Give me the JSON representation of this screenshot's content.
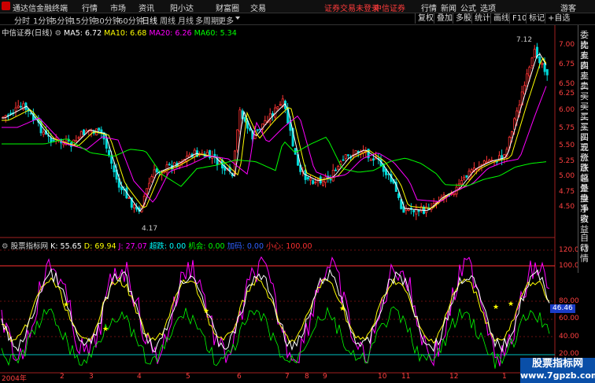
{
  "topbar": {
    "app_name": "通达信金融终端",
    "menus": [
      "行情",
      "市场",
      "资讯",
      "阳小达",
      "财富圈",
      "交易"
    ],
    "notice": "证券交易未登录",
    "broker": "中信证券",
    "right": [
      "行情",
      "新闻",
      "公式",
      "选项"
    ],
    "guest": "游客"
  },
  "periods": [
    "分时",
    "1分钟",
    "5分钟",
    "15分钟",
    "30分钟",
    "60分钟",
    "日线",
    "周线",
    "月线",
    "多周期",
    "更多"
  ],
  "active_period": "日线",
  "toolbar_right": [
    "复权",
    "叠加",
    "多股",
    "统计",
    "画线",
    "F10",
    "标记",
    "+自选"
  ],
  "ma": {
    "title": "中信证券(日线)",
    "items": [
      {
        "label": "MA5: 6.72",
        "color": "#ffffff"
      },
      {
        "label": "MA10: 6.68",
        "color": "#ffff00"
      },
      {
        "label": "MA20: 6.26",
        "color": "#ff00ff"
      },
      {
        "label": "MA60: 5.34",
        "color": "#00ff00"
      }
    ]
  },
  "price_axis": [
    "7.00",
    "6.75",
    "6.50",
    "6.25",
    "6.00",
    "5.75",
    "5.50",
    "5.25",
    "5.00",
    "4.75",
    "4.50"
  ],
  "high_label": "7.12",
  "low_label": "4.17",
  "kdj": {
    "title": "股票指标网",
    "items": [
      {
        "label": "K: 55.65",
        "color": "#ffffff"
      },
      {
        "label": "D: 69.94",
        "color": "#ffff00"
      },
      {
        "label": "J: 27.07",
        "color": "#ff00ff"
      },
      {
        "label": "超跌: 0.00",
        "color": "#00ffff"
      },
      {
        "label": "机会: 0.00",
        "color": "#00ff00"
      },
      {
        "label": "加码: 0.00",
        "color": "#3060ff"
      },
      {
        "label": "小心: 100.00",
        "color": "#ff3030"
      }
    ]
  },
  "kdj_axis": [
    "120.0",
    "100.0",
    "80.00",
    "60.00",
    "40.00",
    "20.00"
  ],
  "kdj_current": "46.46",
  "x_axis": [
    "2004年",
    "2",
    "3",
    "4",
    "5",
    "6",
    "7",
    "8",
    "9",
    "10",
    "11",
    "12",
    "1"
  ],
  "right_panel": [
    "委比",
    "卖五",
    "卖四",
    "卖三",
    "卖二",
    "卖一",
    "买一",
    "买二",
    "买三",
    "买四",
    "买五",
    "现价",
    "涨跌",
    "涨幅",
    "总量",
    "外盘",
    "换手",
    "净资",
    "收益",
    "自动",
    "行情"
  ],
  "watermark": {
    "line1": "股票指标网",
    "line2": "www.7gpzb.com"
  },
  "colors": {
    "up": "#ff3333",
    "down": "#00d8d8",
    "accent_red": "#ff3c3c"
  }
}
